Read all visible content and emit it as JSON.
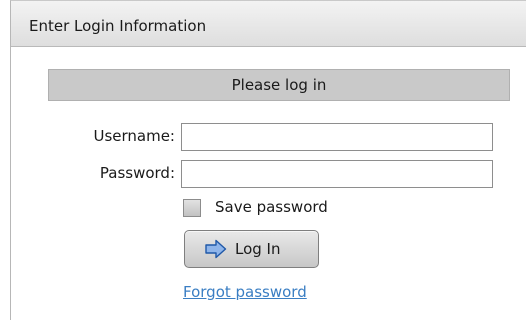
{
  "panel": {
    "title": "Enter Login Information"
  },
  "banner": {
    "text": "Please log in"
  },
  "form": {
    "username": {
      "label": "Username:",
      "value": ""
    },
    "password": {
      "label": "Password:",
      "value": ""
    },
    "save_password": {
      "label": "Save password",
      "checked": false
    },
    "login_button": {
      "label": "Log In",
      "icon": "arrow-right-icon"
    },
    "forgot_link": {
      "label": "Forgot password"
    }
  },
  "colors": {
    "link": "#3a7ec3",
    "banner_bg": "#c9c9c9",
    "header_bg": "#e6e6e6",
    "icon_fill": "#8fb5ea",
    "icon_stroke": "#1f58a8"
  }
}
